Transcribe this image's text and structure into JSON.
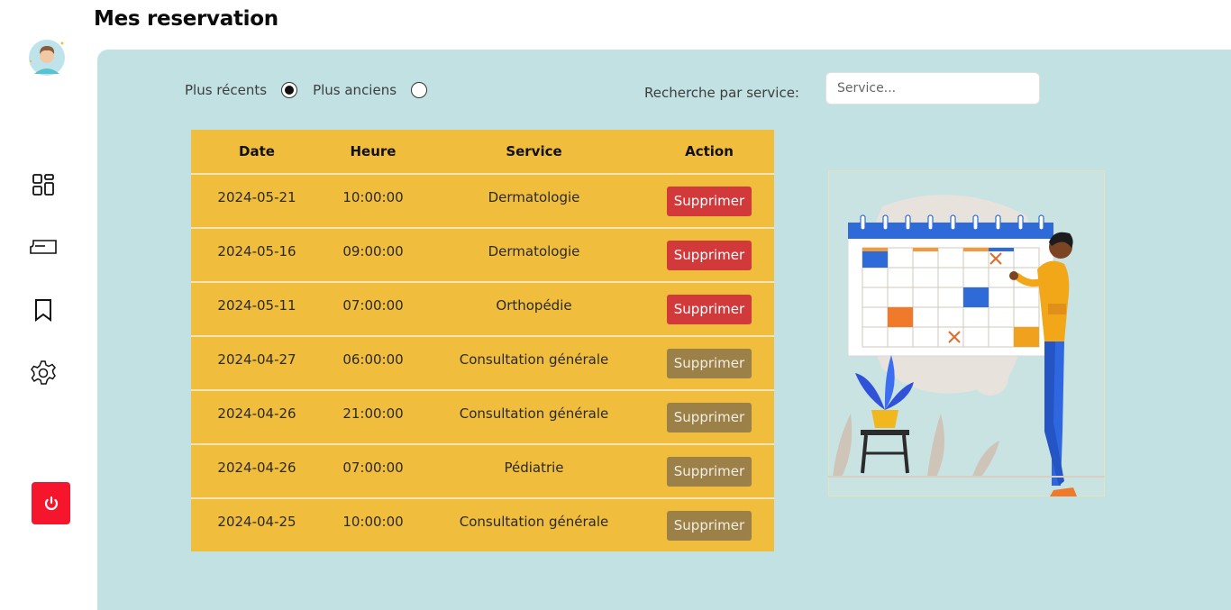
{
  "page": {
    "title": "Mes reservation"
  },
  "sidebar": {
    "items": [
      {
        "name": "dashboard",
        "icon": "dashboard-icon"
      },
      {
        "name": "tickets",
        "icon": "ticket-icon"
      },
      {
        "name": "bookmarks",
        "icon": "bookmark-icon"
      },
      {
        "name": "settings",
        "icon": "gear-icon"
      }
    ],
    "logout_icon": "power-icon",
    "logout_color": "#f5152c"
  },
  "filters": {
    "sort_recent_label": "Plus récents",
    "sort_old_label": "Plus anciens",
    "selected": "recent",
    "search_label": "Recherche par service:",
    "search_placeholder": "Service...",
    "search_value": ""
  },
  "table": {
    "headers": [
      "Date",
      "Heure",
      "Service",
      "Action"
    ],
    "rows": [
      {
        "date": "2024-05-21",
        "time": "10:00:00",
        "service": "Dermatologie",
        "action": "Supprimer",
        "action_enabled": true
      },
      {
        "date": "2024-05-16",
        "time": "09:00:00",
        "service": "Dermatologie",
        "action": "Supprimer",
        "action_enabled": true
      },
      {
        "date": "2024-05-11",
        "time": "07:00:00",
        "service": "Orthopédie",
        "action": "Supprimer",
        "action_enabled": true
      },
      {
        "date": "2024-04-27",
        "time": "06:00:00",
        "service": "Consultation générale",
        "action": "Supprimer",
        "action_enabled": false
      },
      {
        "date": "2024-04-26",
        "time": "21:00:00",
        "service": "Consultation générale",
        "action": "Supprimer",
        "action_enabled": false
      },
      {
        "date": "2024-04-26",
        "time": "07:00:00",
        "service": "Pédiatrie",
        "action": "Supprimer",
        "action_enabled": false
      },
      {
        "date": "2024-04-25",
        "time": "10:00:00",
        "service": "Consultation générale",
        "action": "Supprimer",
        "action_enabled": false
      }
    ]
  },
  "colors": {
    "panel": "#c2e1e3",
    "table": "#f0bd3c",
    "delete_active": "#d2393b",
    "delete_disabled": "#9b8047"
  }
}
